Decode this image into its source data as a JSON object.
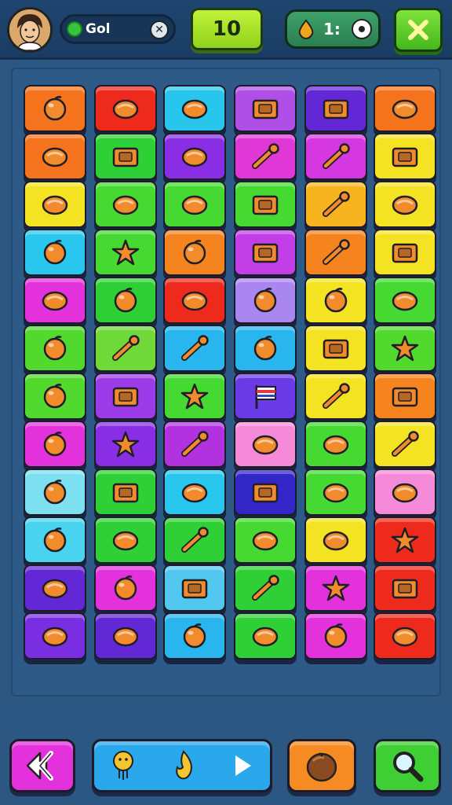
{
  "header": {
    "player_name": "Gol",
    "score": "10",
    "coins": "1:"
  },
  "board": {
    "columns": 6,
    "rows": 12,
    "tiles": [
      {
        "color": "#f5731d",
        "icon": "orange-icon"
      },
      {
        "color": "#ee2a1d",
        "icon": "cheese-wedge-icon"
      },
      {
        "color": "#28c6ec",
        "icon": "green-blob-icon"
      },
      {
        "color": "#b04ee8",
        "icon": "wood-house-icon"
      },
      {
        "color": "#6228d6",
        "icon": "birdhouse-icon"
      },
      {
        "color": "#f5731d",
        "icon": "bowling-ball-icon"
      },
      {
        "color": "#f5731d",
        "icon": "cheese-block-icon"
      },
      {
        "color": "#2fd036",
        "icon": "photo-frame-icon"
      },
      {
        "color": "#8a2ee6",
        "icon": "pear-icon"
      },
      {
        "color": "#e038d6",
        "icon": "drum-icon"
      },
      {
        "color": "#d538e0",
        "icon": "robot-arm-icon"
      },
      {
        "color": "#f4e323",
        "icon": "keyboard-icon"
      },
      {
        "color": "#f4e323",
        "icon": "meat-icon"
      },
      {
        "color": "#45d932",
        "icon": "stones-icon"
      },
      {
        "color": "#45d932",
        "icon": "planet-icon"
      },
      {
        "color": "#45d932",
        "icon": "radio-icon"
      },
      {
        "color": "#f7b41f",
        "icon": "bandage-icon"
      },
      {
        "color": "#f4e323",
        "icon": "clock-icon"
      },
      {
        "color": "#29c7ee",
        "icon": "plum-icon"
      },
      {
        "color": "#45d932",
        "icon": "gear-icon"
      },
      {
        "color": "#f5831e",
        "icon": "cat-cookie-icon"
      },
      {
        "color": "#c23ee6",
        "icon": "camera-icon"
      },
      {
        "color": "#f5831e",
        "icon": "plug-icon"
      },
      {
        "color": "#f4e323",
        "icon": "frame-icon"
      },
      {
        "color": "#e332dc",
        "icon": "marshmallow-icon"
      },
      {
        "color": "#2fd036",
        "icon": "apple-icon"
      },
      {
        "color": "#ee2a1d",
        "icon": "fries-icon"
      },
      {
        "color": "#a986f0",
        "icon": "donut-icon"
      },
      {
        "color": "#f4e323",
        "icon": "cookie-icon"
      },
      {
        "color": "#45d932",
        "icon": "lock-icon"
      },
      {
        "color": "#52d92e",
        "icon": "strawberry-icon"
      },
      {
        "color": "#6fd93a",
        "icon": "brush-icon"
      },
      {
        "color": "#29b5ee",
        "icon": "key-icon"
      },
      {
        "color": "#29b5ee",
        "icon": "lemon-icon"
      },
      {
        "color": "#f4e323",
        "icon": "box-icon"
      },
      {
        "color": "#52d92e",
        "icon": "flower-icon"
      },
      {
        "color": "#52d92e",
        "icon": "green-apple-icon"
      },
      {
        "color": "#9b3ce8",
        "icon": "camera-icon"
      },
      {
        "color": "#45d932",
        "icon": "sun-icon"
      },
      {
        "color": "#6a3ae6",
        "icon": "flag-icon"
      },
      {
        "color": "#f4e323",
        "icon": "pin-icon"
      },
      {
        "color": "#f5831e",
        "icon": "device-icon"
      },
      {
        "color": "#e332dc",
        "icon": "lime-icon"
      },
      {
        "color": "#8a2ee6",
        "icon": "gear-icon"
      },
      {
        "color": "#b232e0",
        "icon": "wrench-icon"
      },
      {
        "color": "#f58ad8",
        "icon": "cracker-icon"
      },
      {
        "color": "#45d932",
        "icon": "mortar-icon"
      },
      {
        "color": "#f4e323",
        "icon": "magnifier-icon"
      },
      {
        "color": "#7de0f0",
        "icon": "orange-icon"
      },
      {
        "color": "#2fd036",
        "icon": "chest-icon"
      },
      {
        "color": "#29c7ee",
        "icon": "ring-icon"
      },
      {
        "color": "#3326c6",
        "icon": "calendar-icon"
      },
      {
        "color": "#45d932",
        "icon": "letter-p-icon"
      },
      {
        "color": "#f58ad8",
        "icon": "leather-icon"
      },
      {
        "color": "#49d3ee",
        "icon": "apple-icon"
      },
      {
        "color": "#2fd036",
        "icon": "bolt-icon"
      },
      {
        "color": "#2fd036",
        "icon": "pencil-icon"
      },
      {
        "color": "#45d932",
        "icon": "boot-icon"
      },
      {
        "color": "#f4e323",
        "icon": "pie-icon"
      },
      {
        "color": "#ee2a1d",
        "icon": "star-icon"
      },
      {
        "color": "#6228d6",
        "icon": "pot-icon"
      },
      {
        "color": "#e332dc",
        "icon": "tart-icon"
      },
      {
        "color": "#52c8ef",
        "icon": "toolbox-icon"
      },
      {
        "color": "#2fd036",
        "icon": "feather-icon"
      },
      {
        "color": "#e332dc",
        "icon": "sunflower-icon"
      },
      {
        "color": "#ee2a1d",
        "icon": "camera-icon"
      },
      {
        "color": "#7a2ee2",
        "icon": "cheese-icon"
      },
      {
        "color": "#6228d6",
        "icon": "carrot-icon"
      },
      {
        "color": "#29b5ee",
        "icon": "lemon-icon"
      },
      {
        "color": "#2fd036",
        "icon": "bread-icon"
      },
      {
        "color": "#e332dc",
        "icon": "plum-icon"
      },
      {
        "color": "#ee2a1d",
        "icon": "funnel-icon"
      }
    ]
  },
  "bottom": {
    "back_icon": "back-arrow-icon",
    "play_icons": [
      "bulb-icon",
      "flame-icon",
      "play-icon"
    ],
    "hint_icon": "coconut-icon",
    "search_icon": "magnifier-icon"
  }
}
